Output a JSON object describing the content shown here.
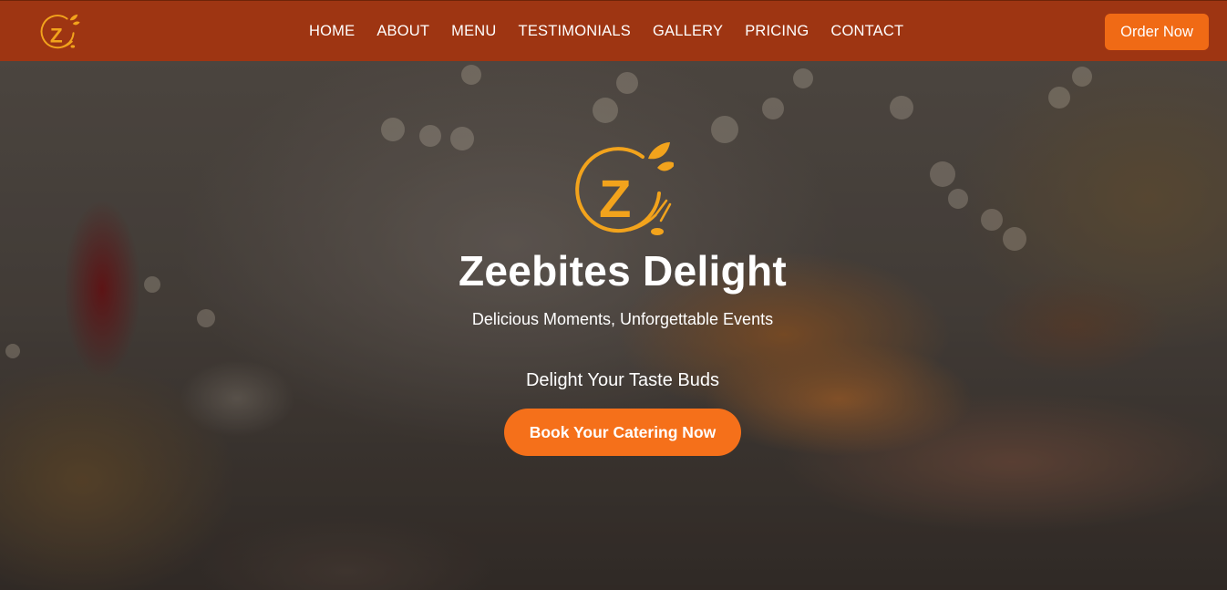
{
  "brand": {
    "logo_icon": "zeebites-z-leaf-fork-logo-icon",
    "accent_color": "#f06a15",
    "nav_color": "#9e3512",
    "logo_color": "#f2a31c"
  },
  "nav": {
    "links": [
      "HOME",
      "ABOUT",
      "MENU",
      "TESTIMONIALS",
      "GALLERY",
      "PRICING",
      "CONTACT"
    ],
    "order_button": "Order Now"
  },
  "hero": {
    "title": "Zeebites Delight",
    "subtitle": "Delicious Moments, Unforgettable Events",
    "tagline": "Delight Your Taste Buds",
    "cta": "Book Your Catering Now"
  }
}
